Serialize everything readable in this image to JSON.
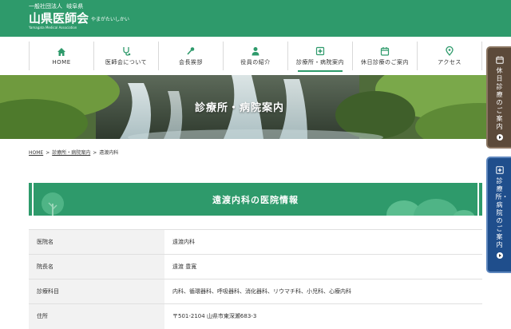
{
  "header": {
    "org_prefix": "一般社団法人",
    "prefecture": "岐阜県",
    "name": "山県医師会",
    "kana": "やまがたいしかい",
    "english": "Yamagata Medical Association"
  },
  "nav": {
    "items": [
      {
        "label": "HOME",
        "icon": "home-icon"
      },
      {
        "label": "医師会について",
        "icon": "stethoscope-icon"
      },
      {
        "label": "会長挨拶",
        "icon": "microphone-icon"
      },
      {
        "label": "役員の紹介",
        "icon": "person-icon"
      },
      {
        "label": "診療所・病院案内",
        "icon": "hospital-icon"
      },
      {
        "label": "休日診療のご案内",
        "icon": "calendar-icon"
      },
      {
        "label": "アクセス",
        "icon": "pin-icon"
      }
    ]
  },
  "hero": {
    "title": "診療所・病院案内"
  },
  "breadcrumb": {
    "home": "HOME",
    "sep": ">",
    "parent": "診療所・病院案内",
    "current": "遠渡内科"
  },
  "section": {
    "title": "遠渡内科の医院情報"
  },
  "info_table": {
    "rows": [
      {
        "label": "医院名",
        "value": "遠渡内科"
      },
      {
        "label": "院長名",
        "value": "遠渡 豊寛"
      },
      {
        "label": "診療科目",
        "value": "内科、循環器科、呼吸器科、消化器科、リウマチ科、小児科、心療内科"
      },
      {
        "label": "住所",
        "value": "〒501-2104 山県市東深瀬683-3"
      }
    ]
  },
  "side_tabs": {
    "holiday": "休日診療のご案内",
    "clinic": "診療所・病院のご案内"
  },
  "colors": {
    "brand_green": "#2e9a6b",
    "holiday_tab": "#5c4a3a",
    "clinic_tab": "#1f4e8c"
  }
}
